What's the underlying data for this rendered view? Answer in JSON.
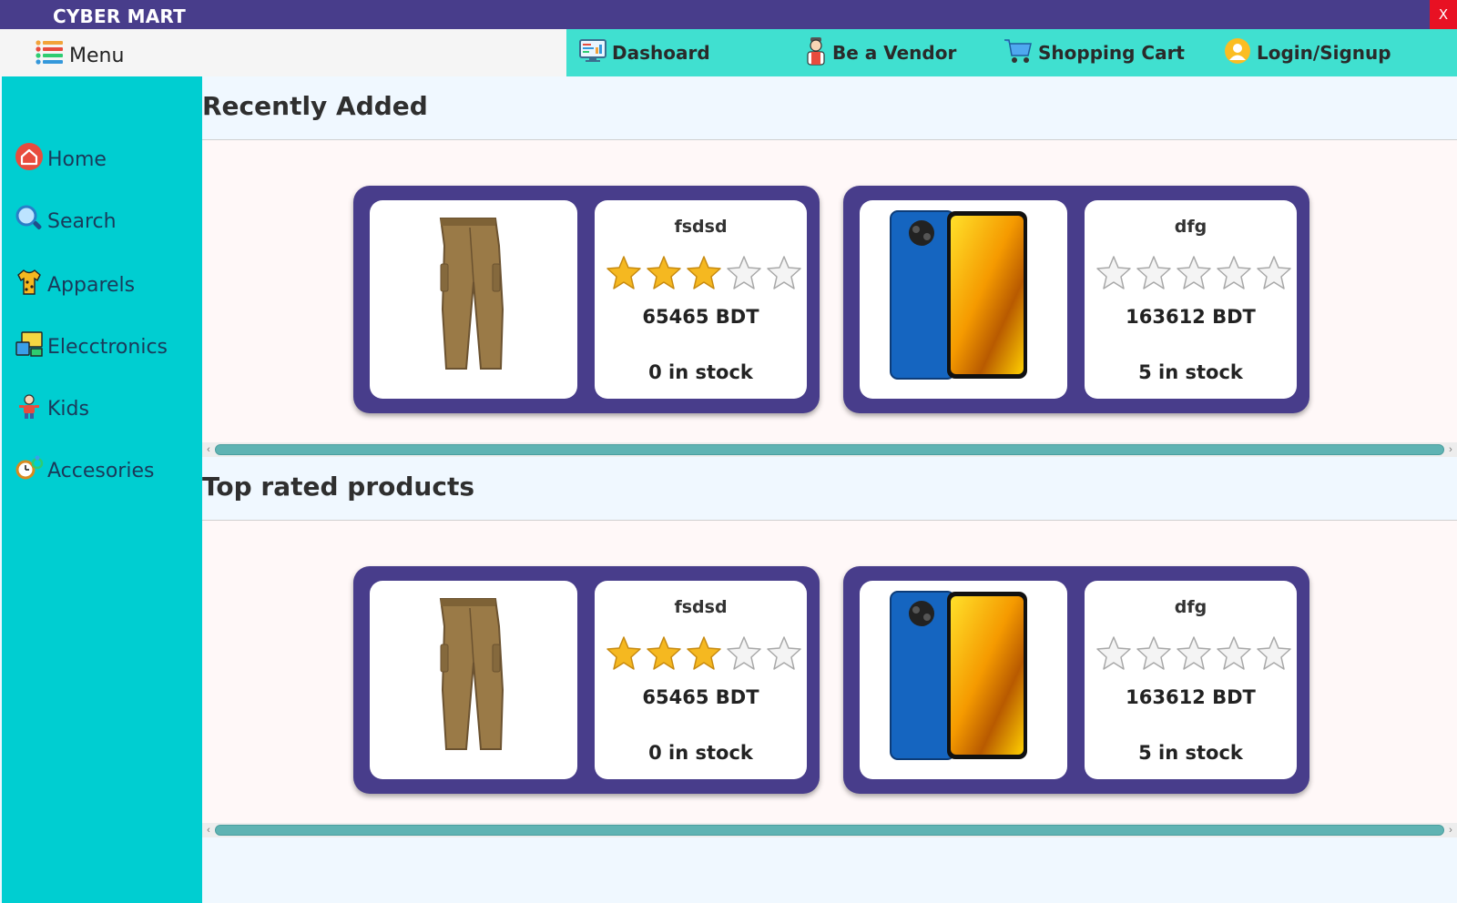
{
  "window": {
    "title": "CYBER MART",
    "close_label": "X",
    "accent": "#483d8b"
  },
  "menu": {
    "label": "Menu"
  },
  "topnav": [
    {
      "label": "Dashoard",
      "icon": "dashboard-icon"
    },
    {
      "label": "Be a Vendor",
      "icon": "vendor-icon"
    },
    {
      "label": "Shopping Cart",
      "icon": "cart-icon"
    },
    {
      "label": "Login/Signup",
      "icon": "user-icon"
    }
  ],
  "sidebar": [
    {
      "label": "Home",
      "icon": "home-icon"
    },
    {
      "label": "Search",
      "icon": "search-icon"
    },
    {
      "label": "Apparels",
      "icon": "shirt-icon"
    },
    {
      "label": "Elecctronics",
      "icon": "electronics-icon"
    },
    {
      "label": "Kids",
      "icon": "kids-icon"
    },
    {
      "label": "Accesories",
      "icon": "watch-icon"
    }
  ],
  "sections": [
    {
      "title": "Recently Added",
      "products": [
        {
          "name": "fsdsd",
          "rating": 3,
          "price": "65465 BDT",
          "stock": "0 in stock",
          "image": "trousers"
        },
        {
          "name": "dfg",
          "rating": 0,
          "price": "163612 BDT",
          "stock": "5 in stock",
          "image": "phone"
        }
      ]
    },
    {
      "title": "Top rated products",
      "products": [
        {
          "name": "fsdsd",
          "rating": 3,
          "price": "65465 BDT",
          "stock": "0 in stock",
          "image": "trousers"
        },
        {
          "name": "dfg",
          "rating": 0,
          "price": "163612 BDT",
          "stock": "5 in stock",
          "image": "phone"
        }
      ]
    }
  ],
  "colors": {
    "titlebar": "#483d8b",
    "topnav": "#40e0d0",
    "sidebar": "#00ced1",
    "card": "#483d8b",
    "star_filled": "#f5b820"
  }
}
